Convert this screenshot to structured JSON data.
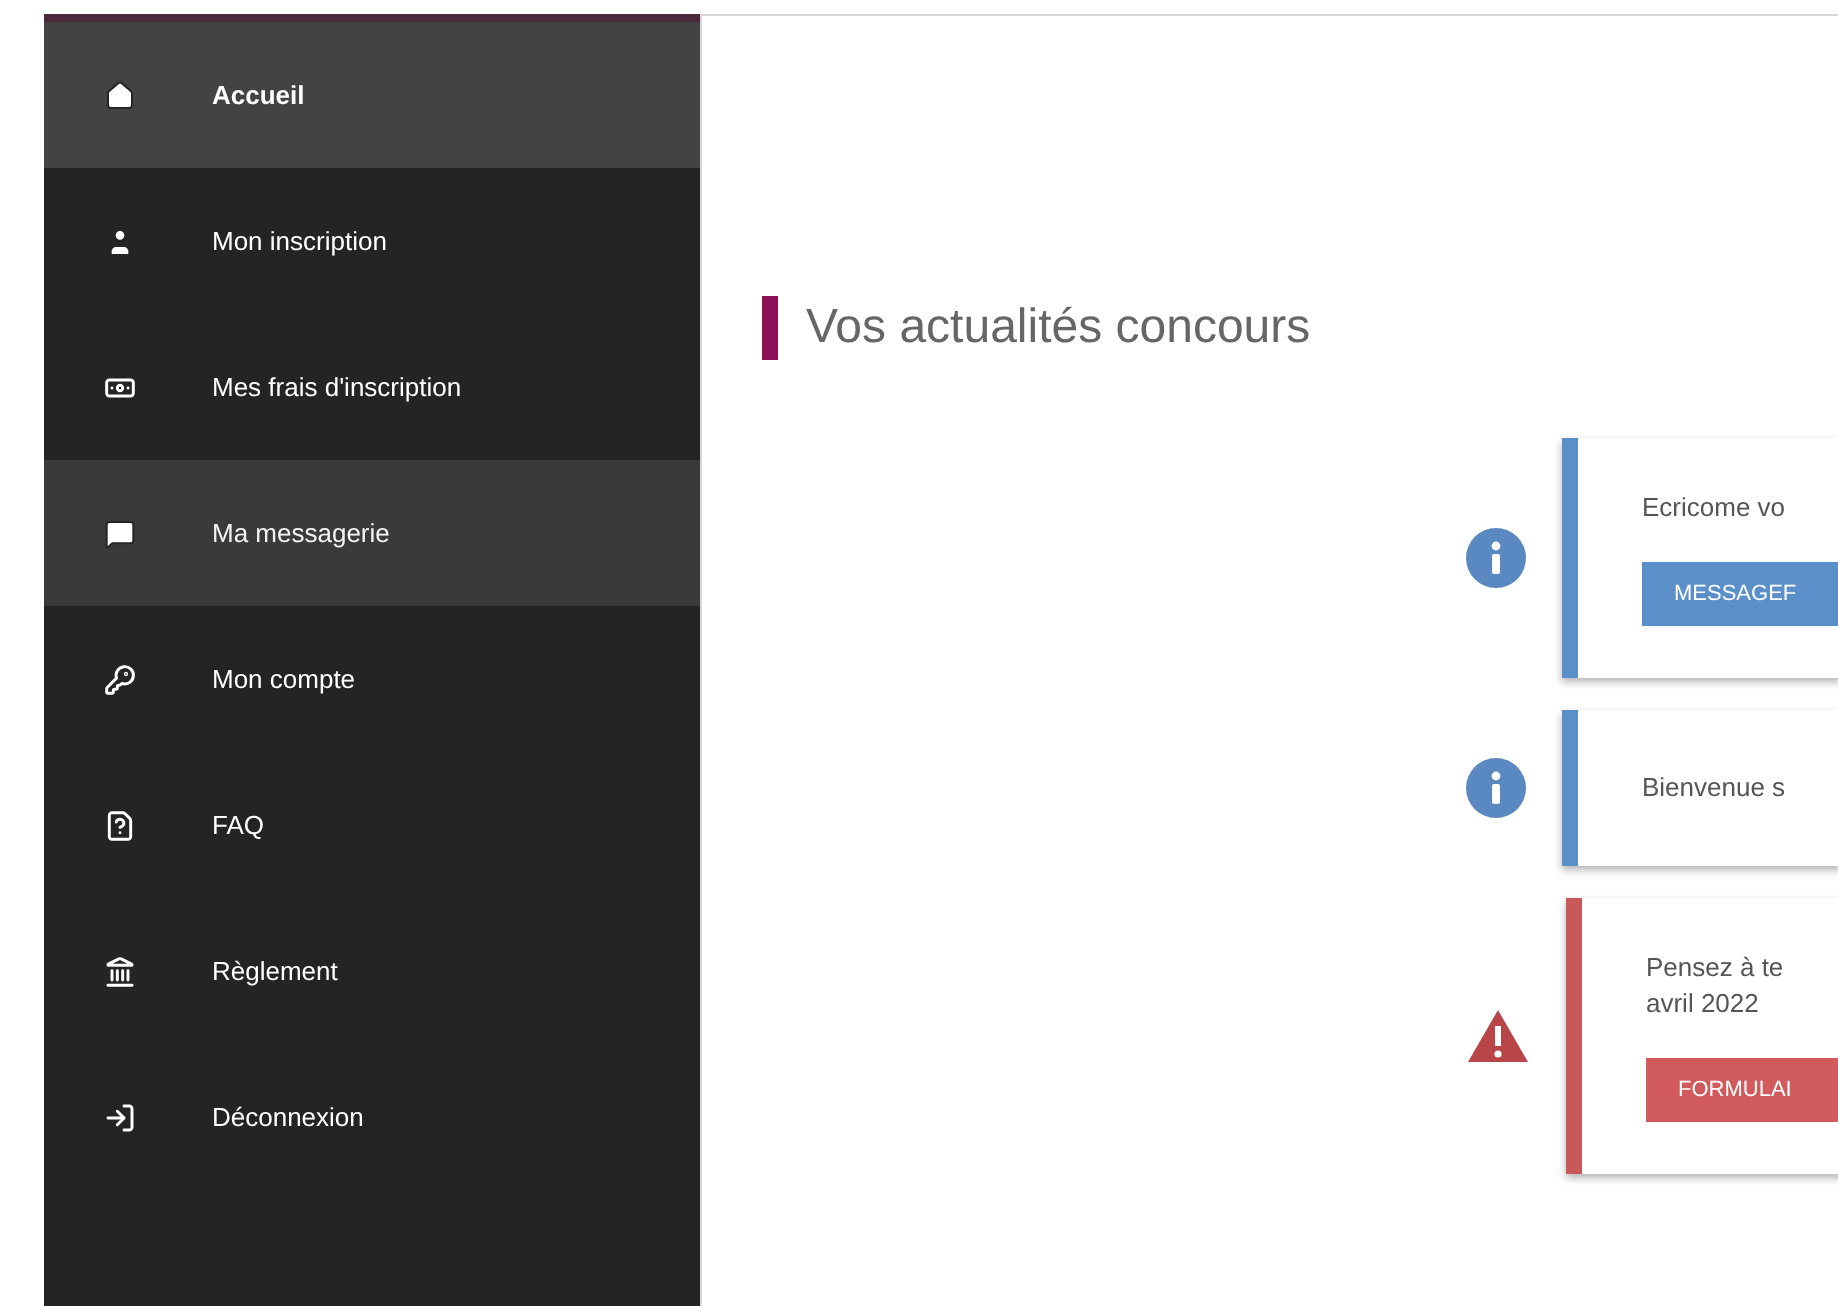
{
  "sidebar": {
    "items": [
      {
        "label": "Accueil",
        "selected": true,
        "hovered": false
      },
      {
        "label": "Mon inscription",
        "selected": false,
        "hovered": false
      },
      {
        "label": "Mes frais d'inscription",
        "selected": false,
        "hovered": false
      },
      {
        "label": "Ma messagerie",
        "selected": false,
        "hovered": true
      },
      {
        "label": "Mon compte",
        "selected": false,
        "hovered": false
      },
      {
        "label": "FAQ",
        "selected": false,
        "hovered": false
      },
      {
        "label": "Règlement",
        "selected": false,
        "hovered": false
      },
      {
        "label": "Déconnexion",
        "selected": false,
        "hovered": false
      }
    ]
  },
  "main": {
    "heading": "Vos actualités concours",
    "news": [
      {
        "kind": "info",
        "lines": [
          "Ecricome vo"
        ],
        "button": "MESSAGEF"
      },
      {
        "kind": "info",
        "lines": [
          "Bienvenue s"
        ]
      },
      {
        "kind": "warning",
        "lines": [
          "Pensez à te",
          "avril 2022"
        ],
        "button": "FORMULAI"
      }
    ]
  }
}
